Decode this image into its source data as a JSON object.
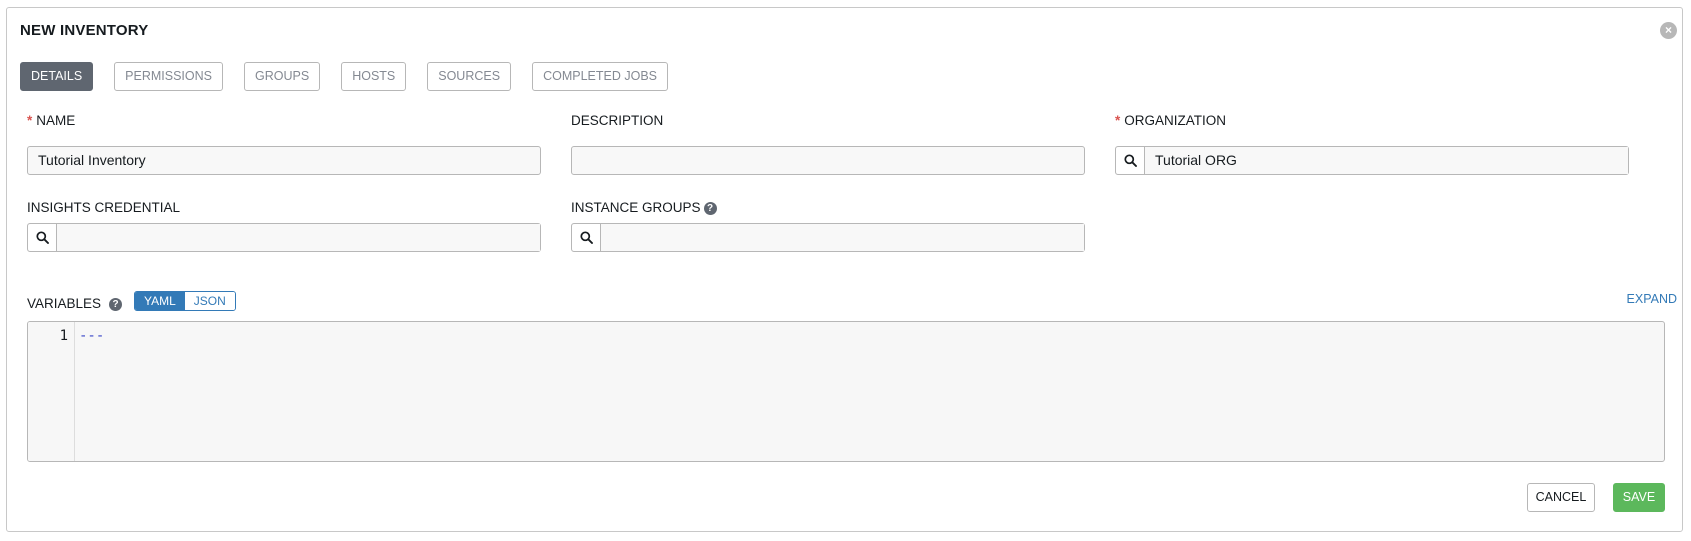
{
  "form": {
    "title": "NEW INVENTORY",
    "close_icon": "close-circle-icon"
  },
  "tabs": [
    {
      "label": "DETAILS",
      "active": true
    },
    {
      "label": "PERMISSIONS",
      "active": false
    },
    {
      "label": "GROUPS",
      "active": false
    },
    {
      "label": "HOSTS",
      "active": false
    },
    {
      "label": "SOURCES",
      "active": false
    },
    {
      "label": "COMPLETED JOBS",
      "active": false
    }
  ],
  "fields": {
    "name": {
      "label": "NAME",
      "required": true,
      "value": "Tutorial Inventory"
    },
    "description": {
      "label": "DESCRIPTION",
      "value": ""
    },
    "organization": {
      "label": "ORGANIZATION",
      "required": true,
      "value": "Tutorial ORG",
      "icon": "search-icon"
    },
    "insights_credential": {
      "label": "INSIGHTS CREDENTIAL",
      "value": "",
      "icon": "search-icon"
    },
    "instance_groups": {
      "label": "INSTANCE GROUPS",
      "value": "",
      "icon": "search-icon",
      "help_icon": "question-circle-icon"
    }
  },
  "variables": {
    "label": "VARIABLES",
    "help_icon": "question-circle-icon",
    "modes": [
      "YAML",
      "JSON"
    ],
    "selected_mode": "YAML",
    "expand_label": "EXPAND",
    "line_numbers": [
      "1"
    ],
    "code_lines": [
      "---"
    ]
  },
  "actions": {
    "cancel_label": "CANCEL",
    "save_label": "SAVE"
  },
  "colors": {
    "primary": "#337ab7",
    "save": "#5cb85c",
    "active_tab": "#5f6670",
    "required": "#d9534f"
  }
}
